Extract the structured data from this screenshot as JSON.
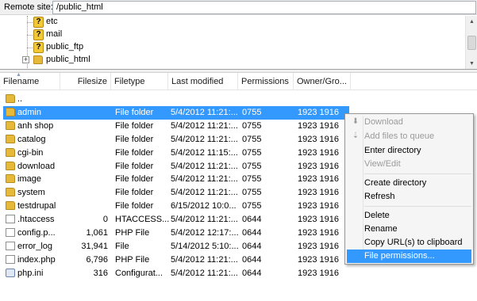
{
  "site_bar": {
    "label": "Remote site:",
    "path": "/public_html"
  },
  "tree": {
    "items": [
      {
        "label": "etc",
        "icon": "question-folder-icon"
      },
      {
        "label": "mail",
        "icon": "question-folder-icon"
      },
      {
        "label": "public_ftp",
        "icon": "question-folder-icon"
      },
      {
        "label": "public_html",
        "icon": "folder-icon",
        "expander": "+"
      }
    ]
  },
  "columns": [
    "Filename",
    "Filesize",
    "Filetype",
    "Last modified",
    "Permissions",
    "Owner/Gro..."
  ],
  "files": [
    {
      "name": "..",
      "size": "",
      "type": "",
      "modified": "",
      "perms": "",
      "owner": "",
      "icon": "folder"
    },
    {
      "name": "admin",
      "size": "",
      "type": "File folder",
      "modified": "5/4/2012 11:21:...",
      "perms": "0755",
      "owner": "1923 1916",
      "icon": "folder"
    },
    {
      "name": "anh shop",
      "size": "",
      "type": "File folder",
      "modified": "5/4/2012 11:21:...",
      "perms": "0755",
      "owner": "1923 1916",
      "icon": "folder"
    },
    {
      "name": "catalog",
      "size": "",
      "type": "File folder",
      "modified": "5/4/2012 11:21:...",
      "perms": "0755",
      "owner": "1923 1916",
      "icon": "folder"
    },
    {
      "name": "cgi-bin",
      "size": "",
      "type": "File folder",
      "modified": "5/4/2012 11:15:...",
      "perms": "0755",
      "owner": "1923 1916",
      "icon": "folder"
    },
    {
      "name": "download",
      "size": "",
      "type": "File folder",
      "modified": "5/4/2012 11:21:...",
      "perms": "0755",
      "owner": "1923 1916",
      "icon": "folder"
    },
    {
      "name": "image",
      "size": "",
      "type": "File folder",
      "modified": "5/4/2012 11:21:...",
      "perms": "0755",
      "owner": "1923 1916",
      "icon": "folder"
    },
    {
      "name": "system",
      "size": "",
      "type": "File folder",
      "modified": "5/4/2012 11:21:...",
      "perms": "0755",
      "owner": "1923 1916",
      "icon": "folder"
    },
    {
      "name": "testdrupal",
      "size": "",
      "type": "File folder",
      "modified": "6/15/2012 10:0...",
      "perms": "0755",
      "owner": "1923 1916",
      "icon": "folder"
    },
    {
      "name": ".htaccess",
      "size": "0",
      "type": "HTACCESS...",
      "modified": "5/4/2012 11:21:...",
      "perms": "0644",
      "owner": "1923 1916",
      "icon": "file"
    },
    {
      "name": "config.p...",
      "size": "1,061",
      "type": "PHP File",
      "modified": "5/4/2012 12:17:...",
      "perms": "0644",
      "owner": "1923 1916",
      "icon": "file"
    },
    {
      "name": "error_log",
      "size": "31,941",
      "type": "File",
      "modified": "5/14/2012 5:10:...",
      "perms": "0644",
      "owner": "1923 1916",
      "icon": "file"
    },
    {
      "name": "index.php",
      "size": "6,796",
      "type": "PHP File",
      "modified": "5/4/2012 11:21:...",
      "perms": "0644",
      "owner": "1923 1916",
      "icon": "file"
    },
    {
      "name": "php.ini",
      "size": "316",
      "type": "Configurat...",
      "modified": "5/4/2012 11:21:...",
      "perms": "0644",
      "owner": "1923 1916",
      "icon": "ini"
    }
  ],
  "selected_row": "admin",
  "context_menu": {
    "download": "Download",
    "add_queue": "Add files to queue",
    "enter_dir": "Enter directory",
    "view_edit": "View/Edit",
    "create_dir": "Create directory",
    "refresh": "Refresh",
    "delete": "Delete",
    "rename": "Rename",
    "copy_url": "Copy URL(s) to clipboard",
    "file_perms": "File permissions..."
  },
  "colors": {
    "selection": "#3399ff",
    "folder": "#e6b93a"
  }
}
